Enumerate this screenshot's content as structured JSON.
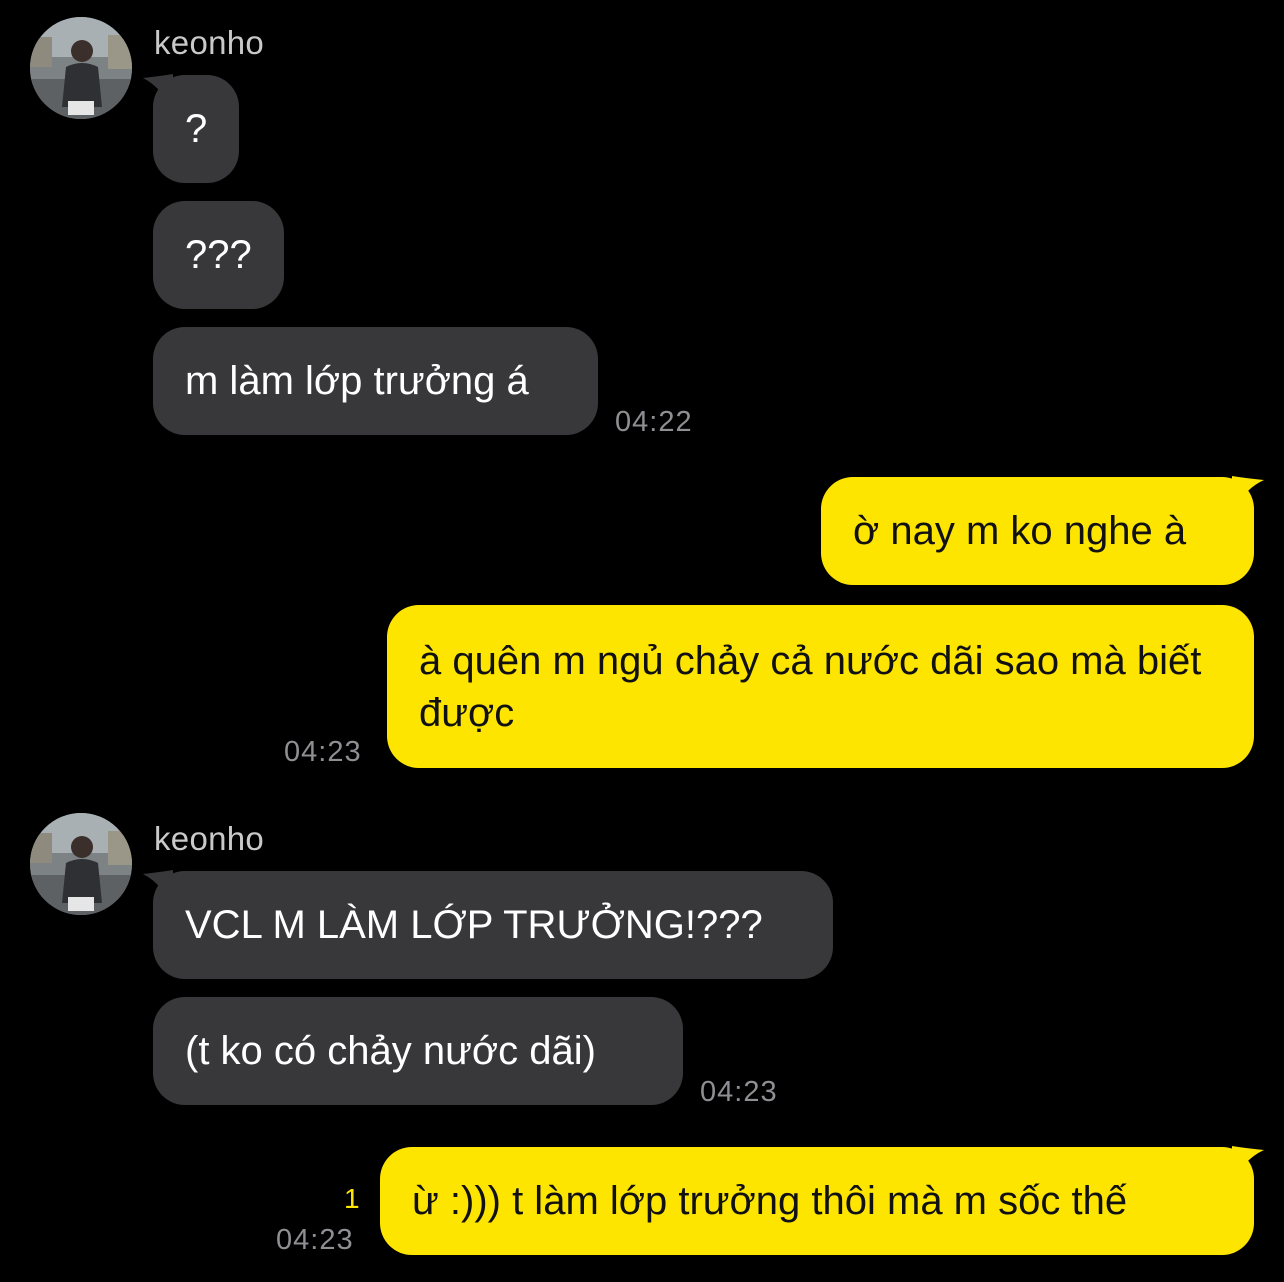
{
  "colors": {
    "background": "#000000",
    "incoming_bubble": "#38383a",
    "outgoing_bubble": "#fee500",
    "timestamp": "#8e8e93",
    "unread_count": "#fee500"
  },
  "groups": [
    {
      "sender": "keonho",
      "messages": [
        {
          "text": "?"
        },
        {
          "text": "???"
        },
        {
          "text": "m làm lớp trưởng á",
          "time": "04:22"
        }
      ]
    },
    {
      "sender": "me",
      "messages": [
        {
          "text": "ờ nay m ko nghe à"
        },
        {
          "text": "à quên m ngủ chảy cả nước dãi sao mà biết được",
          "time": "04:23"
        }
      ]
    },
    {
      "sender": "keonho",
      "messages": [
        {
          "text": "VCL M LÀM LỚP TRƯỞNG!???"
        },
        {
          "text": "(t ko có chảy nước dãi)",
          "time": "04:23"
        }
      ]
    },
    {
      "sender": "me",
      "messages": [
        {
          "text": "ừ :))) t làm lớp trưởng thôi mà m sốc thế",
          "time": "04:23",
          "unread": "1"
        }
      ]
    }
  ]
}
